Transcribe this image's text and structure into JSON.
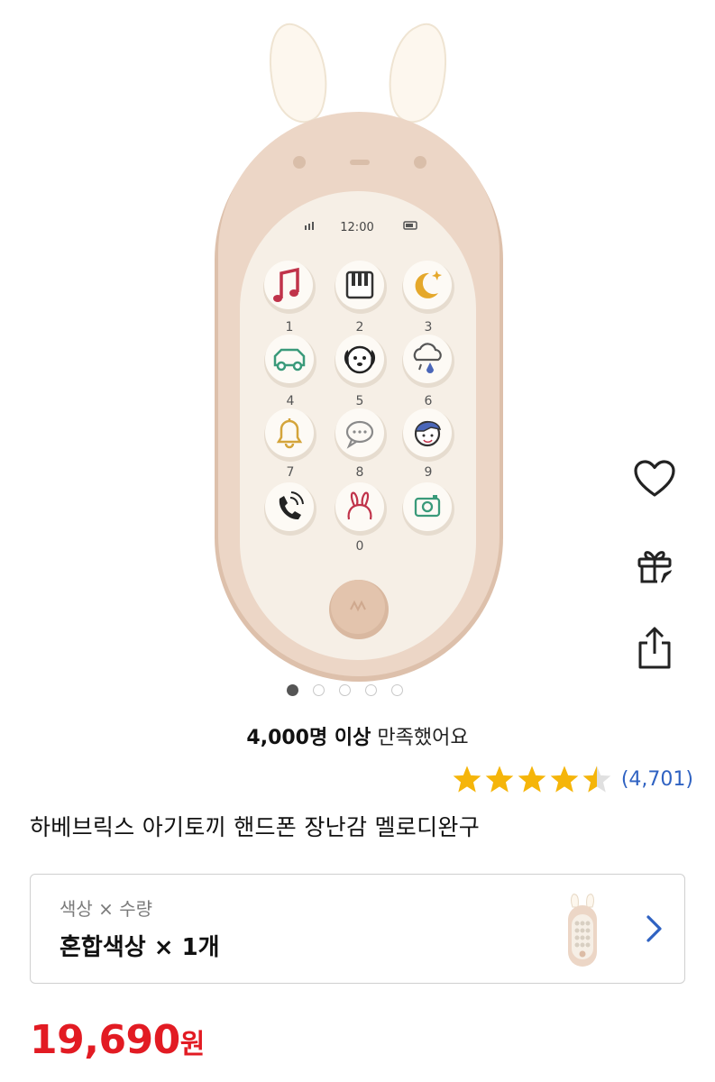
{
  "product_image": {
    "screen_time": "12:00",
    "keypad": [
      {
        "digit": "1",
        "icon": "music-note-icon"
      },
      {
        "digit": "2",
        "icon": "piano-icon"
      },
      {
        "digit": "3",
        "icon": "moon-star-icon"
      },
      {
        "digit": "4",
        "icon": "car-icon"
      },
      {
        "digit": "5",
        "icon": "dog-icon"
      },
      {
        "digit": "6",
        "icon": "rain-cloud-icon"
      },
      {
        "digit": "7",
        "icon": "bell-icon"
      },
      {
        "digit": "8",
        "icon": "chat-bubble-icon"
      },
      {
        "digit": "9",
        "icon": "kid-face-icon"
      },
      {
        "digit": "",
        "icon": "phone-call-icon"
      },
      {
        "digit": "0",
        "icon": "bunny-icon"
      },
      {
        "digit": "",
        "icon": "camera-icon"
      }
    ]
  },
  "carousel": {
    "total": 5,
    "active_index": 0
  },
  "side_actions": [
    {
      "name": "wishlist",
      "icon": "heart-icon"
    },
    {
      "name": "gift",
      "icon": "gift-icon"
    },
    {
      "name": "share",
      "icon": "share-icon"
    }
  ],
  "satisfaction": {
    "bold": "4,000명 이상",
    "rest": " 만족했어요"
  },
  "rating": {
    "stars": 4.5,
    "count": "(4,701)"
  },
  "product": {
    "title": "하베브릭스 아기토끼 핸드폰 장난감 멜로디완구"
  },
  "option": {
    "label": "색상 × 수량",
    "value": "혼합색상 × 1개"
  },
  "price": {
    "amount": "19,690",
    "unit": "원"
  },
  "colors": {
    "price": "#e21b23",
    "star": "#f5b50a",
    "link": "#2f62c2",
    "phone_body": "#ecd6c6",
    "phone_face": "#f6efe6"
  }
}
